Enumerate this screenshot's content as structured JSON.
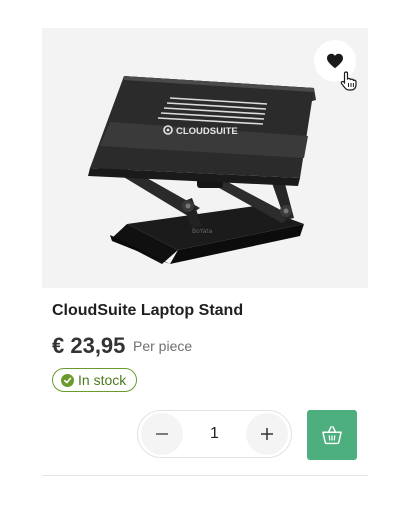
{
  "product": {
    "title": "CloudSuite Laptop Stand",
    "price": "€ 23,95",
    "unit": "Per piece",
    "stock_label": "In stock",
    "image_brand_text": "CLOUDSUITE",
    "quantity": "1"
  },
  "icons": {
    "favorite": "heart-icon",
    "cursor": "hand-pointer-icon",
    "stock": "check-circle-icon",
    "decrease": "minus-icon",
    "increase": "plus-icon",
    "cart": "basket-icon"
  },
  "colors": {
    "accent_green": "#4caf7d",
    "stock_green": "#6a9a2b",
    "image_bg": "#f3f3f3"
  }
}
